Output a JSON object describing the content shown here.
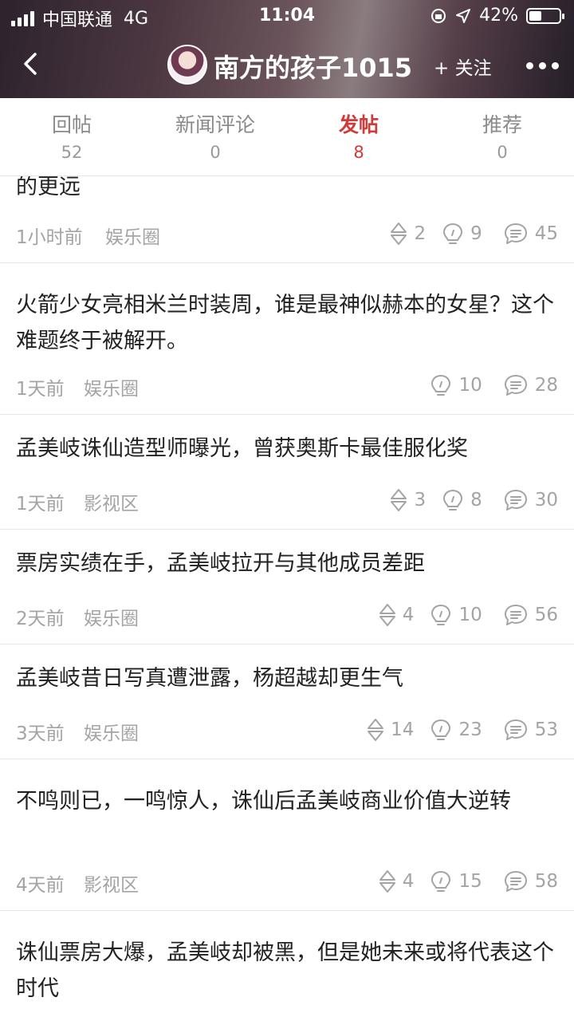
{
  "status_bar": {
    "carrier": "中国联通",
    "network": "4G",
    "time": "11:04",
    "battery": "42%",
    "battery_level": 0.42
  },
  "nav": {
    "title": "南方的孩子1015",
    "follow_label": "+ 关注"
  },
  "tabs": [
    {
      "label": "回帖",
      "count": "52"
    },
    {
      "label": "新闻评论",
      "count": "0"
    },
    {
      "label": "发帖",
      "count": "8"
    },
    {
      "label": "推荐",
      "count": "0"
    }
  ],
  "active_tab": "发帖",
  "colors": {
    "accent": "#d23a3a",
    "meta_text": "#a4a4a4"
  },
  "posts": [
    {
      "title": "的更远",
      "time": "1小时前",
      "category": "娱乐圈",
      "likes": "2",
      "ideas": "9",
      "comments": "45"
    },
    {
      "title": "火箭少女亮相米兰时装周，谁是最神似赫本的女星？这个难题终于被解开。",
      "time": "1天前",
      "category": "娱乐圈",
      "likes": null,
      "ideas": "10",
      "comments": "28"
    },
    {
      "title": "孟美岐诛仙造型师曝光，曾获奥斯卡最佳服化奖",
      "time": "1天前",
      "category": "影视区",
      "likes": "3",
      "ideas": "8",
      "comments": "30"
    },
    {
      "title": "票房实绩在手，孟美岐拉开与其他成员差距",
      "time": "2天前",
      "category": "娱乐圈",
      "likes": "4",
      "ideas": "10",
      "comments": "56"
    },
    {
      "title": "孟美岐昔日写真遭泄露，杨超越却更生气",
      "time": "3天前",
      "category": "娱乐圈",
      "likes": "14",
      "ideas": "23",
      "comments": "53"
    },
    {
      "title": "不鸣则已，一鸣惊人，诛仙后孟美岐商业价值大逆转",
      "time": "4天前",
      "category": "影视区",
      "likes": "4",
      "ideas": "15",
      "comments": "58"
    },
    {
      "title": "诛仙票房大爆，孟美岐却被黑，但是她未来或将代表这个时代",
      "time": null,
      "category": null,
      "likes": null,
      "ideas": null,
      "comments": null
    }
  ]
}
